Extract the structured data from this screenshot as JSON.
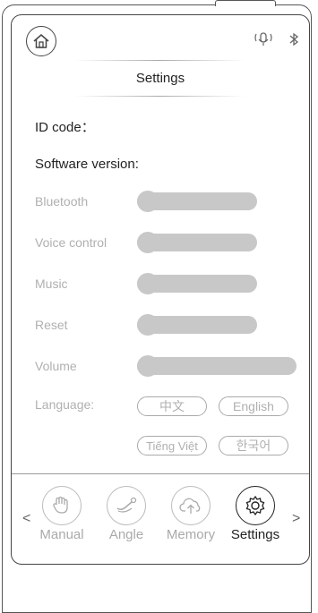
{
  "header": {
    "title": "Settings"
  },
  "info": {
    "id_code_label": "ID code：",
    "software_version_label": "Software version:"
  },
  "settings": [
    {
      "label": "Bluetooth",
      "level": 0
    },
    {
      "label": "Voice control",
      "level": 0
    },
    {
      "label": "Music",
      "level": 0
    },
    {
      "label": "Reset",
      "level": 0
    },
    {
      "label": "Volume",
      "level": 0
    }
  ],
  "language": {
    "label": "Language:",
    "options": [
      "中文",
      "English",
      "Tiếng Việt",
      "한국어"
    ]
  },
  "nav": {
    "prev_glyph": "<",
    "next_glyph": ">",
    "items": [
      {
        "label": "Manual",
        "icon": "hand-icon",
        "active": false
      },
      {
        "label": "Angle",
        "icon": "recline-icon",
        "active": false
      },
      {
        "label": "Memory",
        "icon": "cloud-upload-icon",
        "active": false
      },
      {
        "label": "Settings",
        "icon": "gear-icon",
        "active": true
      }
    ]
  },
  "colors": {
    "inactive": "#b0b0b0",
    "slider": "#c8c8c8",
    "active": "#222222"
  }
}
